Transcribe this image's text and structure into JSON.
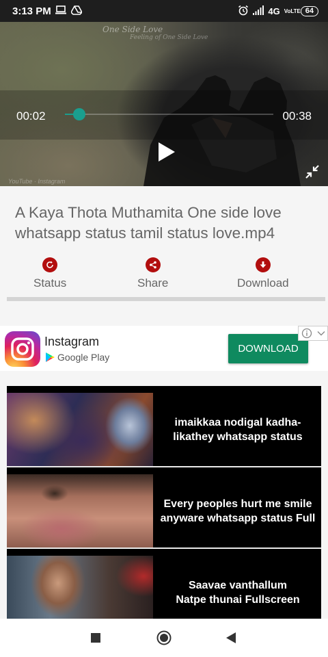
{
  "status_bar": {
    "time": "3:13 PM",
    "network": "4G",
    "volte": "VoLTE",
    "battery": "64"
  },
  "video": {
    "overlay_title": "One Side Love",
    "overlay_subtitle": "Feeling of One Side Love",
    "watermark": "YouTube · Instagram",
    "current_time": "00:02",
    "total_time": "00:38",
    "progress": 0.07,
    "accent_color": "#1a9e8e"
  },
  "video_title": "A Kaya Thota Muthamita One side love whatsapp status tamil status love.mp4",
  "actions": {
    "status_label": "Status",
    "share_label": "Share",
    "download_label": "Download",
    "icon_color": "#b20e0e"
  },
  "ad": {
    "app_name": "Instagram",
    "store": "Google Play",
    "cta": "DOWNLOAD",
    "cta_color": "#0f8a5f"
  },
  "related_videos": [
    {
      "title": "imaikkaa nodigal kadha-\nlikathey whatsapp status"
    },
    {
      "title": "Every  peoples hurt me  smile\nanyware whatsapp status Full"
    },
    {
      "title": "Saavae vanthallum\nNatpe thunai   Fullscreen"
    }
  ]
}
